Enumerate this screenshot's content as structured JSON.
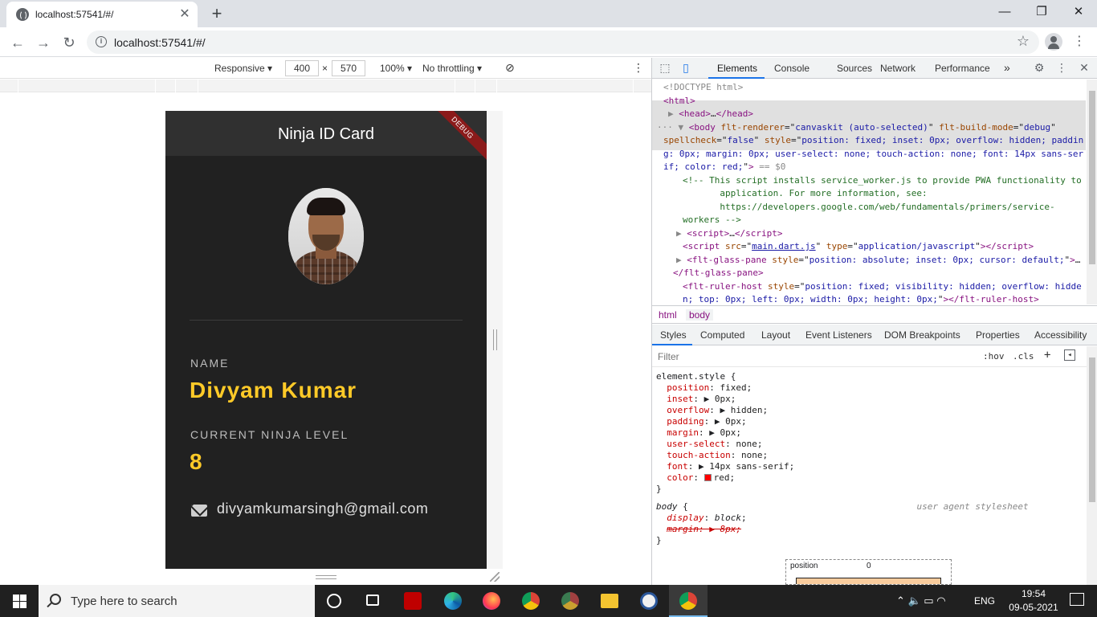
{
  "browser": {
    "tab_title": "localhost:57541/#/",
    "tab_close": "✕",
    "new_tab": "+",
    "url": "localhost:57541/#/",
    "window_controls": [
      "—",
      "❐",
      "✕"
    ]
  },
  "device_toolbar": {
    "mode": "Responsive ▾",
    "width": "400",
    "times": "×",
    "height": "570",
    "zoom": "100% ▾",
    "throttling": "No throttling ▾",
    "rotate_icon": "rotate-icon",
    "more": "⋮"
  },
  "app": {
    "title": "Ninja ID Card",
    "debug_banner": "DEBUG",
    "name_label": "NAME",
    "name_value": "Divyam Kumar",
    "level_label": "CURRENT NINJA LEVEL",
    "level_value": "8",
    "email": "divyamkumarsingh@gmail.com",
    "accent_color": "#ffca28",
    "background_color": "#212121"
  },
  "devtools": {
    "tabs": [
      "Elements",
      "Console",
      "Sources",
      "Network",
      "Performance"
    ],
    "more_tabs": "»",
    "dom_lines": [
      {
        "prefix": "",
        "html": "<span class='gr'>&lt;!DOCTYPE html&gt;</span>"
      },
      {
        "prefix": "",
        "html": "<span class='tag'>&lt;html&gt;</span>"
      },
      {
        "prefix": "▶",
        "html": "<span class='tag'>&lt;head&gt;</span>…<span class='tag'>&lt;/head&gt;</span>"
      },
      {
        "prefix": "··· ▼",
        "html": "<span class='tag'>&lt;body</span> <span class='an'>flt-renderer</span>=\"<span class='av'>canvaskit (auto-selected)</span>\" <span class='an'>flt-build-mode</span>=\"<span class='av'>debug</span>\""
      },
      {
        "prefix": "",
        "html": "<span class='an'>spellcheck</span>=\"<span class='av'>false</span>\" <span class='an'>style</span>=\"<span class='av'>position: fixed; inset: 0px; overflow: hidden; paddin</span>"
      },
      {
        "prefix": "",
        "html": "<span class='av'>g: 0px; margin: 0px; user-select: none; touch-action: none; font: 14px sans-ser</span>"
      },
      {
        "prefix": "",
        "html": "<span class='av'>if; color: red;</span>\"<span class='tag'>&gt;</span> <span class='gr'>== $0</span>"
      },
      {
        "prefix": "",
        "html": "<span class='cm'>&lt;!-- This script installs service_worker.js to provide PWA functionality to</span>"
      },
      {
        "prefix": "",
        "html": "<span class='cm'>       application. For more information, see:</span>"
      },
      {
        "prefix": "",
        "html": "<span class='cm'>       https://developers.google.com/web/fundamentals/primers/service-</span>"
      },
      {
        "prefix": "",
        "html": "<span class='cm'>workers --&gt;</span>"
      },
      {
        "prefix": "▶",
        "html": "<span class='tag'>&lt;script&gt;</span>…<span class='tag'>&lt;/script&gt;</span>"
      },
      {
        "prefix": "",
        "html": "<span class='tag'>&lt;script</span> <span class='an'>src</span>=\"<span class='av' style='text-decoration:underline'>main.dart.js</span>\" <span class='an'>type</span>=\"<span class='av'>application/javascript</span>\"<span class='tag'>&gt;&lt;/script&gt;</span>"
      },
      {
        "prefix": "▶",
        "html": "<span class='tag'>&lt;flt-glass-pane</span> <span class='an'>style</span>=\"<span class='av'>position: absolute; inset: 0px; cursor: default;</span>\"<span class='tag'>&gt;</span>…"
      },
      {
        "prefix": "",
        "html": "<span class='tag'>&lt;/flt-glass-pane&gt;</span>"
      },
      {
        "prefix": "",
        "html": "<span class='tag'>&lt;flt-ruler-host</span> <span class='an'>style</span>=\"<span class='av'>position: fixed; visibility: hidden; overflow: hidde</span>"
      },
      {
        "prefix": "",
        "html": "<span class='av'>n; top: 0px; left: 0px; width: 0px; height: 0px;</span>\"<span class='tag'>&gt;&lt;/flt-ruler-host&gt;</span>"
      }
    ],
    "breadcrumbs": [
      "html",
      "body"
    ],
    "sub_tabs": [
      "Styles",
      "Computed",
      "Layout",
      "Event Listeners",
      "DOM Breakpoints",
      "Properties",
      "Accessibility"
    ],
    "filter_placeholder": "Filter",
    "filter_opts": [
      ":hov",
      ".cls",
      "+"
    ],
    "styles_lines": [
      {
        "html": "element.style {"
      },
      {
        "html": "  <span class='pn'>position</span>: <span class='pv'>fixed</span>;"
      },
      {
        "html": "  <span class='pn'>inset</span>: ▶ <span class='pv'>0px</span>;"
      },
      {
        "html": "  <span class='pn'>overflow</span>: ▶ <span class='pv'>hidden</span>;"
      },
      {
        "html": "  <span class='pn'>padding</span>: ▶ <span class='pv'>0px</span>;"
      },
      {
        "html": "  <span class='pn'>margin</span>: ▶ <span class='pv'>0px</span>;"
      },
      {
        "html": "  <span class='pn'>user-select</span>: <span class='pv'>none</span>;"
      },
      {
        "html": "  <span class='pn'>touch-action</span>: <span class='pv'>none</span>;"
      },
      {
        "html": "  <span class='pn'>font</span>: ▶ <span class='pv'>14px sans-serif</span>;"
      },
      {
        "html": "  <span class='pn'>color</span>: <span class='swatch'></span><span class='pv'>red</span>;"
      },
      {
        "html": "}"
      },
      {
        "html": "<span class='ital'>body</span> {                                           <span class='ital gr'>user agent stylesheet</span>"
      },
      {
        "html": "  <span class='pn ital'>display</span>: <span class='ital'>block</span>;"
      },
      {
        "html": "  <span class='strike ital'>margin: ▶ 8px;</span>"
      },
      {
        "html": "}"
      }
    ],
    "box_model": {
      "label": "position",
      "value": "0"
    }
  },
  "taskbar": {
    "search_text": "Type here to search",
    "tray_lang": "ENG",
    "time": "19:54",
    "date": "09-05-2021",
    "tray_icons": "⌃  🔈  ▭  ◠"
  }
}
